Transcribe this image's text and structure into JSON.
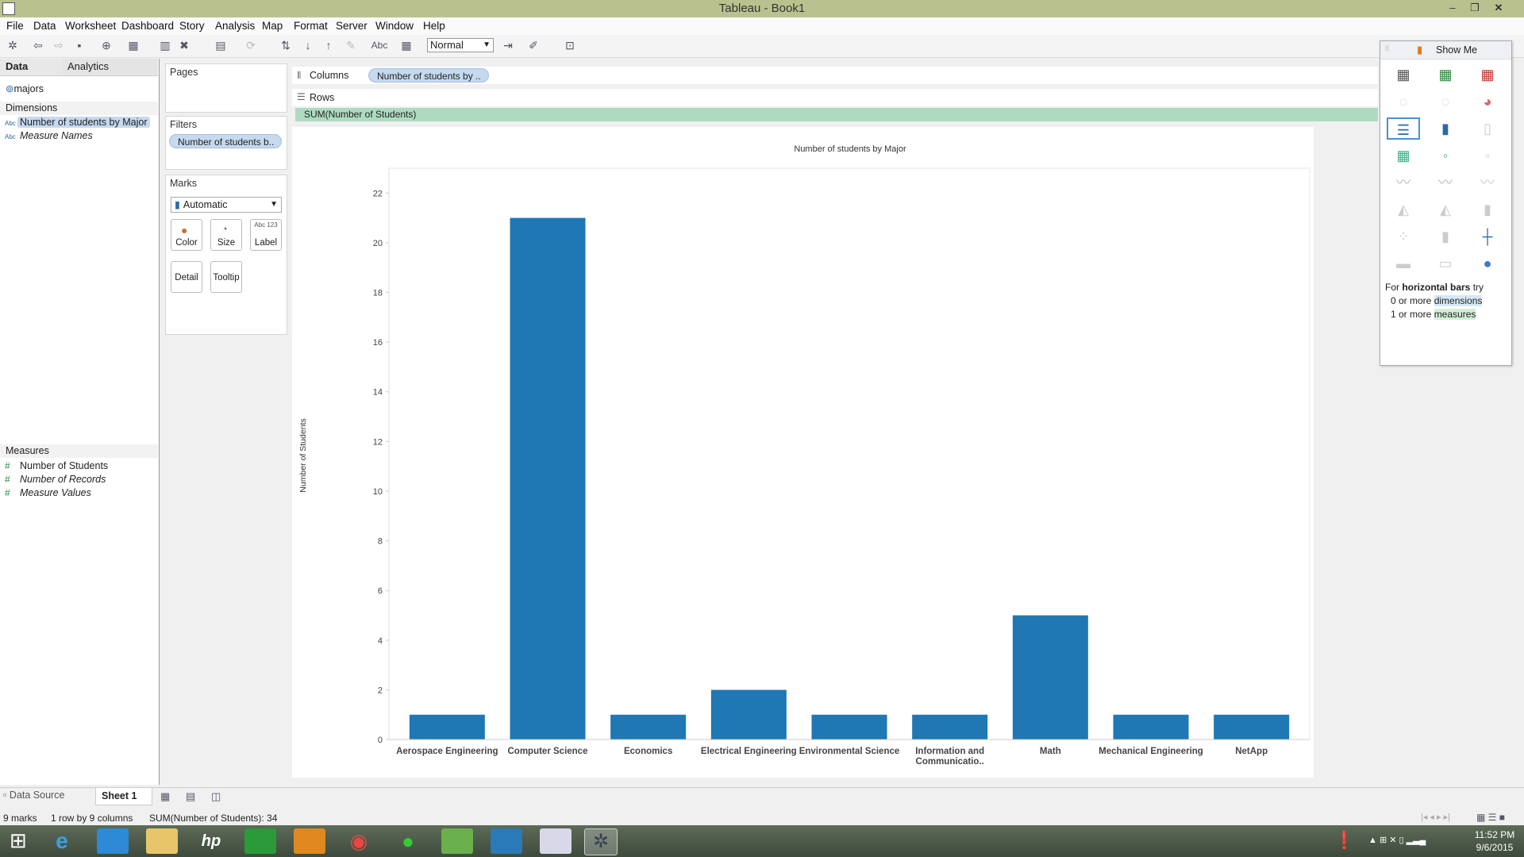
{
  "window": {
    "title": "Tableau - Book1"
  },
  "menu": [
    "File",
    "Data",
    "Worksheet",
    "Dashboard",
    "Story",
    "Analysis",
    "Map",
    "Format",
    "Server",
    "Window",
    "Help"
  ],
  "toolbar": {
    "abc_label": "Abc",
    "fit_value": "Normal"
  },
  "data_pane": {
    "tabs": [
      "Data",
      "Analytics"
    ],
    "datasource": "majors",
    "dimensions_header": "Dimensions",
    "dimensions": [
      "Number of students by Major",
      "Measure Names"
    ],
    "abc": "Abc",
    "measures_header": "Measures",
    "measures": [
      "Number of Students",
      "Number of Records",
      "Measure Values"
    ]
  },
  "pages_card": {
    "title": "Pages"
  },
  "filters_card": {
    "title": "Filters",
    "pill": "Number of students b.."
  },
  "marks_card": {
    "title": "Marks",
    "type": "Automatic",
    "buttons": [
      "Color",
      "Size",
      "Label",
      "Detail",
      "Tooltip"
    ],
    "label_glyph": "Abc 123"
  },
  "shelves": {
    "columns_label": "Columns",
    "columns_pill": "Number of students by ..",
    "rows_label": "Rows",
    "rows_pill": "SUM(Number of Students)"
  },
  "chart_data": {
    "type": "bar",
    "title": "Number of students by Major",
    "ylabel": "Number of Students",
    "xlabel": "",
    "categories": [
      "Aerospace Engineering",
      "Computer Science",
      "Economics",
      "Electrical Engineering",
      "Environmental Science",
      "Information and Communicatio..",
      "Math",
      "Mechanical Engineering",
      "NetApp"
    ],
    "values": [
      1,
      21,
      1,
      2,
      1,
      1,
      5,
      1,
      1
    ],
    "ylim": [
      0,
      23
    ],
    "yticks": [
      0,
      2,
      4,
      6,
      8,
      10,
      12,
      14,
      16,
      18,
      20,
      22
    ],
    "bar_color": "#1f77b4",
    "grid": false
  },
  "show_me": {
    "title": "Show Me",
    "hint_prefix": "For ",
    "hint_bold": "horizontal bars",
    "hint_suffix": " try",
    "line1_prefix": "0 or more ",
    "line1_term": "dimensions",
    "line2_prefix": "1 or more ",
    "line2_term": "measures"
  },
  "sheet_tabs": {
    "datasource": "Data Source",
    "sheet": "Sheet 1"
  },
  "status": {
    "marks": "9 marks",
    "shape": "1 row by 9 columns",
    "sum": "SUM(Number of Students): 34"
  },
  "clock": {
    "time": "11:52 PM",
    "date": "9/6/2015"
  }
}
